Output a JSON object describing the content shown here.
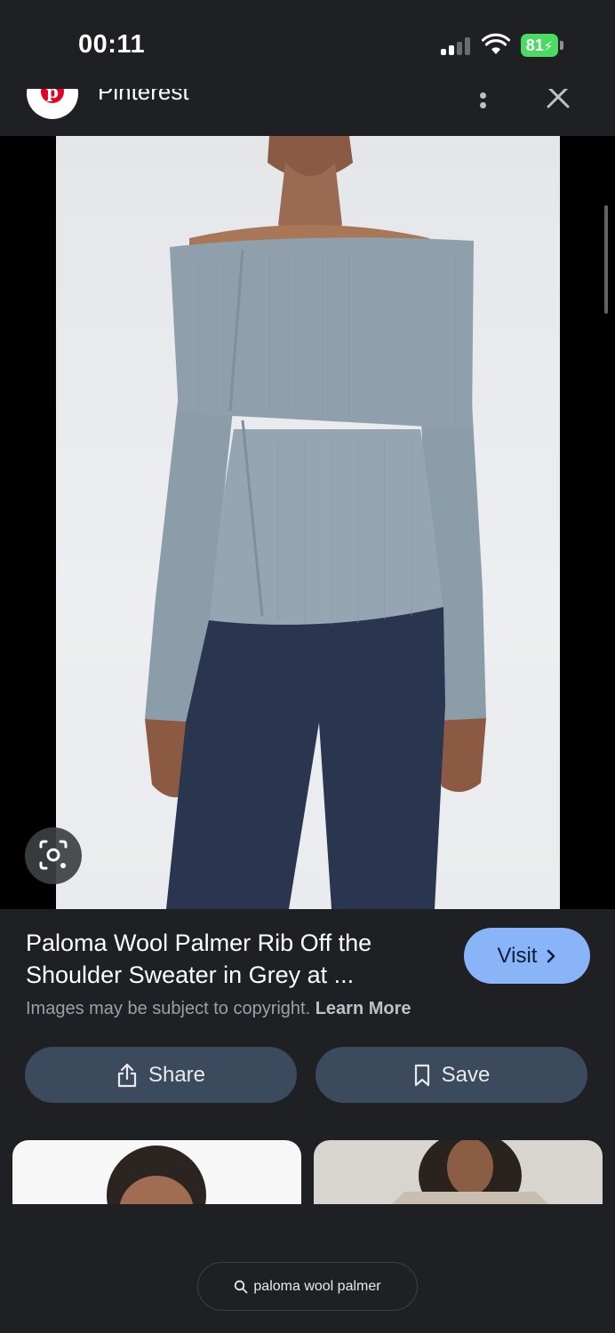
{
  "status_bar": {
    "time": "00:11",
    "battery": "81"
  },
  "header": {
    "source_name": "Pinterest",
    "logo_letter": "p"
  },
  "result": {
    "title": "Paloma Wool Palmer Rib Off the Shoulder Sweater in Grey at ...",
    "copyright_text": "Images may be subject to copyright.",
    "learn_more_label": "Learn More",
    "visit_label": "Visit"
  },
  "actions": {
    "share_label": "Share",
    "save_label": "Save"
  },
  "search": {
    "query": "paloma wool palmer"
  },
  "colors": {
    "background": "#1f2023",
    "visit_button": "#8ab4f8",
    "action_button": "#3c4a5e",
    "battery": "#4cd964",
    "pinterest_red": "#e60023"
  }
}
